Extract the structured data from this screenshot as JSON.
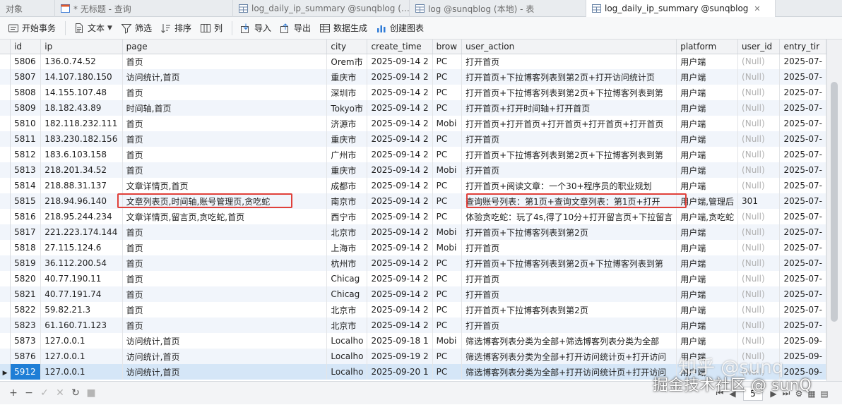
{
  "tabs": [
    {
      "label": "对象",
      "icon": "none",
      "active": false
    },
    {
      "label": "* 无标题 - 查询",
      "icon": "query-icon",
      "active": false
    },
    {
      "label": "log_daily_ip_summary @sunqblog (…",
      "icon": "table-icon",
      "active": false
    },
    {
      "label": "log @sunqblog (本地) - 表",
      "icon": "table-icon",
      "active": false
    },
    {
      "label": "log_daily_ip_summary @sunqblog",
      "icon": "table-icon",
      "active": true
    }
  ],
  "toolbar": {
    "begin_tx": "开始事务",
    "text": "文本",
    "filter": "筛选",
    "sort": "排序",
    "columns": "列",
    "import": "导入",
    "export": "导出",
    "data_gen": "数据生成",
    "create_chart": "创建图表"
  },
  "columns": [
    "id",
    "ip",
    "page",
    "city",
    "create_time",
    "brow",
    "user_action",
    "platform",
    "user_id",
    "entry_tir"
  ],
  "rows": [
    [
      "5806",
      "136.0.74.52",
      "首页",
      "Orem市",
      "2025-09-14 2",
      "PC",
      "打开首页",
      "用户端",
      "(Null)",
      "2025-07-"
    ],
    [
      "5807",
      "14.107.180.150",
      "访问统计,首页",
      "重庆市",
      "2025-09-14 2",
      "PC",
      "打开首页+下拉博客列表到第2页+打开访问统计页",
      "用户端",
      "(Null)",
      "2025-07-"
    ],
    [
      "5808",
      "14.155.107.48",
      "首页",
      "深圳市",
      "2025-09-14 2",
      "PC",
      "打开首页+下拉博客列表到第2页+下拉博客列表到第",
      "用户端",
      "(Null)",
      "2025-07-"
    ],
    [
      "5809",
      "18.182.43.89",
      "时间轴,首页",
      "Tokyo市",
      "2025-09-14 2",
      "PC",
      "打开首页+打开时间轴+打开首页",
      "用户端",
      "(Null)",
      "2025-07-"
    ],
    [
      "5810",
      "182.118.232.111",
      "首页",
      "济源市",
      "2025-09-14 2",
      "Mobi",
      "打开首页+打开首页+打开首页+打开首页+打开首页",
      "用户端",
      "(Null)",
      "2025-07-"
    ],
    [
      "5811",
      "183.230.182.156",
      "首页",
      "重庆市",
      "2025-09-14 2",
      "PC",
      "打开首页",
      "用户端",
      "(Null)",
      "2025-07-"
    ],
    [
      "5812",
      "183.6.103.158",
      "首页",
      "广州市",
      "2025-09-14 2",
      "PC",
      "打开首页+下拉博客列表到第2页+下拉博客列表到第",
      "用户端",
      "(Null)",
      "2025-07-"
    ],
    [
      "5813",
      "218.201.34.52",
      "首页",
      "重庆市",
      "2025-09-14 2",
      "Mobi",
      "打开首页",
      "用户端",
      "(Null)",
      "2025-07-"
    ],
    [
      "5814",
      "218.88.31.137",
      "文章详情页,首页",
      "成都市",
      "2025-09-14 2",
      "PC",
      "打开首页+阅读文章：一个30+程序员的职业规划",
      "用户端",
      "(Null)",
      "2025-07-"
    ],
    [
      "5815",
      "218.94.96.140",
      "文章列表页,时间轴,账号管理页,贪吃蛇",
      "南京市",
      "2025-09-14 2",
      "PC",
      "查询账号列表：第1页+查询文章列表：第1页+打开",
      "用户端,管理后",
      "301",
      "2025-07-"
    ],
    [
      "5816",
      "218.95.244.234",
      "文章详情页,留言页,贪吃蛇,首页",
      "西宁市",
      "2025-09-14 2",
      "PC",
      "体验贪吃蛇：玩了4s,得了10分+打开留言页+下拉留言",
      "用户端,贪吃蛇",
      "(Null)",
      "2025-07-"
    ],
    [
      "5817",
      "221.223.174.144",
      "首页",
      "北京市",
      "2025-09-14 2",
      "Mobi",
      "打开首页+下拉博客列表到第2页",
      "用户端",
      "(Null)",
      "2025-07-"
    ],
    [
      "5818",
      "27.115.124.6",
      "首页",
      "上海市",
      "2025-09-14 2",
      "Mobi",
      "打开首页",
      "用户端",
      "(Null)",
      "2025-07-"
    ],
    [
      "5819",
      "36.112.200.54",
      "首页",
      "杭州市",
      "2025-09-14 2",
      "PC",
      "打开首页+下拉博客列表到第2页+下拉博客列表到第",
      "用户端",
      "(Null)",
      "2025-07-"
    ],
    [
      "5820",
      "40.77.190.11",
      "首页",
      "Chicag",
      "2025-09-14 2",
      "PC",
      "打开首页",
      "用户端",
      "(Null)",
      "2025-07-"
    ],
    [
      "5821",
      "40.77.191.74",
      "首页",
      "Chicag",
      "2025-09-14 2",
      "PC",
      "打开首页",
      "用户端",
      "(Null)",
      "2025-07-"
    ],
    [
      "5822",
      "59.82.21.3",
      "首页",
      "北京市",
      "2025-09-14 2",
      "PC",
      "打开首页+下拉博客列表到第2页",
      "用户端",
      "(Null)",
      "2025-07-"
    ],
    [
      "5823",
      "61.160.71.123",
      "首页",
      "北京市",
      "2025-09-14 2",
      "PC",
      "打开首页",
      "用户端",
      "(Null)",
      "2025-07-"
    ],
    [
      "5873",
      "127.0.0.1",
      "访问统计,首页",
      "Localho",
      "2025-09-18 1",
      "Mobi",
      "筛选博客列表分类为全部+筛选博客列表分类为全部",
      "用户端",
      "(Null)",
      "2025-09-"
    ],
    [
      "5876",
      "127.0.0.1",
      "访问统计,首页",
      "Localho",
      "2025-09-19 2",
      "PC",
      "筛选博客列表分类为全部+打开访问统计页+打开访问",
      "用户端",
      "(Null)",
      "2025-09-"
    ],
    [
      "5912",
      "127.0.0.1",
      "访问统计,首页",
      "Localho",
      "2025-09-20 1",
      "PC",
      "筛选博客列表分类为全部+打开访问统计页+打开访问",
      "用户端",
      "(Null)",
      "2025-09-"
    ]
  ],
  "selected_row": 20,
  "pagination": {
    "page": "5"
  },
  "watermarks": {
    "line1": "知乎 @sunq",
    "line2": "掘金技术社区 @ sunQ"
  },
  "colors": {
    "highlight_box": "#e0403a",
    "selected_id_bg": "#1f7ed6",
    "null_text": "#b0b0b0"
  }
}
